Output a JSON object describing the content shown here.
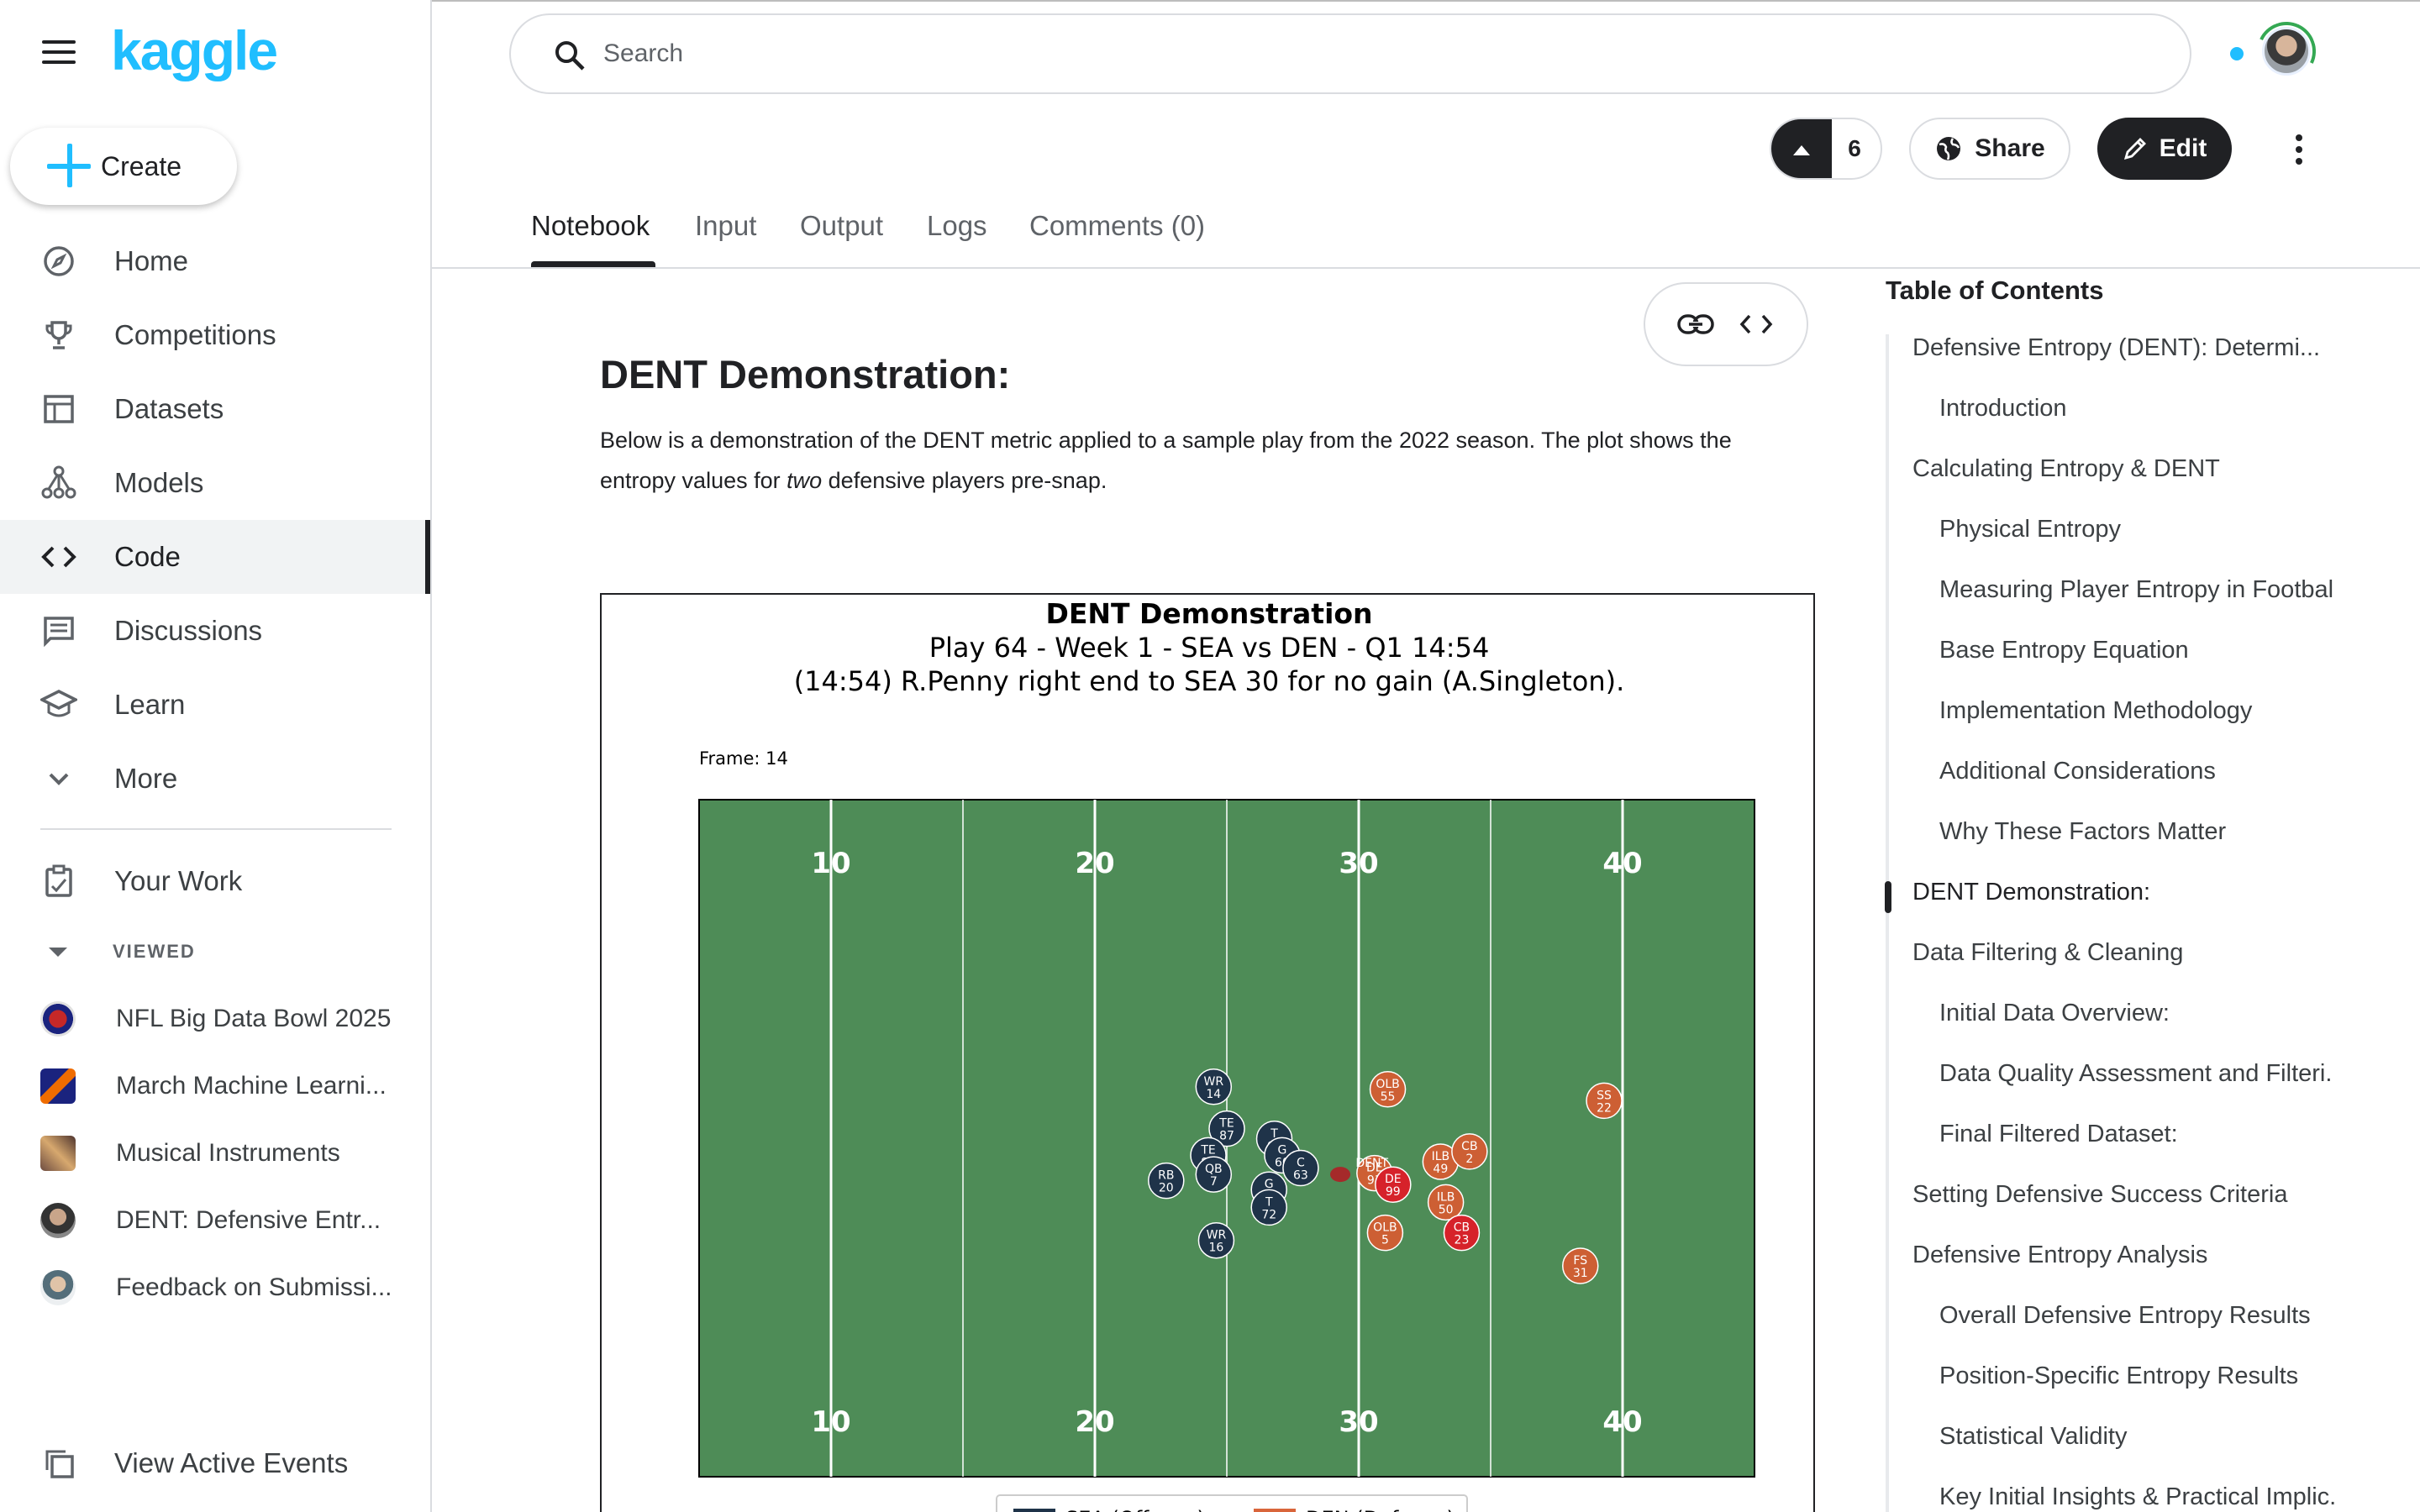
{
  "sidebar": {
    "logo": "kaggle",
    "create_label": "Create",
    "nav": [
      {
        "label": "Home",
        "icon": "compass-icon"
      },
      {
        "label": "Competitions",
        "icon": "trophy-icon"
      },
      {
        "label": "Datasets",
        "icon": "table-icon"
      },
      {
        "label": "Models",
        "icon": "models-icon"
      },
      {
        "label": "Code",
        "icon": "code-icon",
        "active": true
      },
      {
        "label": "Discussions",
        "icon": "discussions-icon"
      },
      {
        "label": "Learn",
        "icon": "learn-icon"
      },
      {
        "label": "More",
        "icon": "chevron-down-icon"
      }
    ],
    "your_work": "Your Work",
    "viewed_label": "VIEWED",
    "recent": [
      {
        "label": "NFL Big Data Bowl 2025"
      },
      {
        "label": "March Machine Learni..."
      },
      {
        "label": "Musical Instruments"
      },
      {
        "label": "DENT: Defensive Entr..."
      },
      {
        "label": "Feedback on Submissi..."
      }
    ],
    "view_active_events": "View Active Events"
  },
  "header": {
    "search_placeholder": "Search",
    "upvotes": "6",
    "share_label": "Share",
    "edit_label": "Edit"
  },
  "tabs": [
    {
      "label": "Notebook",
      "active": true
    },
    {
      "label": "Input"
    },
    {
      "label": "Output"
    },
    {
      "label": "Logs"
    },
    {
      "label": "Comments (0)"
    }
  ],
  "notebook": {
    "heading": "DENT Demonstration:",
    "para_pre": "Below is a demonstration of the DENT metric applied to a sample play from the 2022 season. The plot shows the entropy values for ",
    "para_em": "two",
    "para_post": " defensive players pre-snap."
  },
  "chart_data": {
    "type": "scatter",
    "title": "DENT Demonstration",
    "subtitle_1": "Play 64 - Week 1 - SEA vs DEN - Q1 14:54",
    "subtitle_2": "(14:54) R.Penny right end to SEA 30 for no gain (A.Singleton).",
    "frame_label": "Frame: 14",
    "field_color": "#4e8c57",
    "xlim": [
      5,
      45
    ],
    "ylim": [
      0,
      53.3
    ],
    "yard_numbers": [
      "10",
      "20",
      "30",
      "40"
    ],
    "legend": [
      {
        "label": "SEA (Offense)",
        "color": "#1f3349"
      },
      {
        "label": "DEN (Defense)",
        "color": "#d9653b"
      }
    ],
    "offense_color": "#1f3349",
    "defense_color": "#cd5f34",
    "dent_color": "#d6222a",
    "players": [
      {
        "team": "SEA",
        "pos": "WR",
        "num": "14",
        "x": 24.5,
        "y": 30.7
      },
      {
        "team": "SEA",
        "pos": "TE",
        "num": "87",
        "x": 25.0,
        "y": 27.4
      },
      {
        "team": "SEA",
        "pos": "TE",
        "num": "89",
        "x": 24.3,
        "y": 25.3
      },
      {
        "team": "SEA",
        "pos": "RB",
        "num": "20",
        "x": 22.7,
        "y": 23.3
      },
      {
        "team": "SEA",
        "pos": "QB",
        "num": "7",
        "x": 24.5,
        "y": 23.8
      },
      {
        "team": "SEA",
        "pos": "T",
        "num": "67",
        "x": 26.8,
        "y": 26.6
      },
      {
        "team": "SEA",
        "pos": "G",
        "num": "60",
        "x": 27.1,
        "y": 25.3
      },
      {
        "team": "SEA",
        "pos": "C",
        "num": "63",
        "x": 27.8,
        "y": 24.3
      },
      {
        "team": "SEA",
        "pos": "G",
        "num": "66",
        "x": 26.6,
        "y": 22.6
      },
      {
        "team": "SEA",
        "pos": "T",
        "num": "72",
        "x": 26.6,
        "y": 21.2
      },
      {
        "team": "SEA",
        "pos": "WR",
        "num": "16",
        "x": 24.6,
        "y": 18.6
      },
      {
        "team": "DEN",
        "pos": "OLB",
        "num": "55",
        "x": 31.1,
        "y": 30.5
      },
      {
        "team": "DEN",
        "pos": "DE",
        "num": "93",
        "x": 30.6,
        "y": 23.9
      },
      {
        "team": "DEN",
        "pos": "DE",
        "num": "99",
        "x": 31.3,
        "y": 23.0
      },
      {
        "team": "DEN",
        "pos": "ILB",
        "num": "49",
        "x": 33.1,
        "y": 24.8
      },
      {
        "team": "DEN",
        "pos": "CB",
        "num": "2",
        "x": 34.2,
        "y": 25.6
      },
      {
        "team": "DEN",
        "pos": "ILB",
        "num": "50",
        "x": 33.3,
        "y": 21.6
      },
      {
        "team": "DEN",
        "pos": "OLB",
        "num": "5",
        "x": 31.0,
        "y": 19.2
      },
      {
        "team": "DEN",
        "pos": "CB",
        "num": "23",
        "x": 33.9,
        "y": 19.2
      },
      {
        "team": "DEN",
        "pos": "SS",
        "num": "22",
        "x": 39.3,
        "y": 29.6
      },
      {
        "team": "DEN",
        "pos": "FS",
        "num": "31",
        "x": 38.4,
        "y": 16.6
      }
    ],
    "dent_marker": {
      "label": "DENT",
      "x": 30.5,
      "y": 24.8
    },
    "football": {
      "x": 29.3,
      "y": 23.8
    }
  },
  "toc": {
    "title": "Table of Contents",
    "items": [
      {
        "label": "Defensive Entropy (DENT): Determi...",
        "level": 1
      },
      {
        "label": "Introduction",
        "level": 2
      },
      {
        "label": "Calculating Entropy & DENT",
        "level": 1
      },
      {
        "label": "Physical Entropy",
        "level": 2
      },
      {
        "label": "Measuring Player Entropy in Footbal",
        "level": 2
      },
      {
        "label": "Base Entropy Equation",
        "level": 2
      },
      {
        "label": "Implementation Methodology",
        "level": 2
      },
      {
        "label": "Additional Considerations",
        "level": 2
      },
      {
        "label": "Why These Factors Matter",
        "level": 2
      },
      {
        "label": "DENT Demonstration:",
        "level": 1,
        "active": true
      },
      {
        "label": "Data Filtering & Cleaning",
        "level": 1
      },
      {
        "label": "Initial Data Overview:",
        "level": 2
      },
      {
        "label": "Data Quality Assessment and Filteri.",
        "level": 2
      },
      {
        "label": "Final Filtered Dataset:",
        "level": 2
      },
      {
        "label": "Setting Defensive Success Criteria",
        "level": 1
      },
      {
        "label": "Defensive Entropy Analysis",
        "level": 1
      },
      {
        "label": "Overall Defensive Entropy Results",
        "level": 2
      },
      {
        "label": "Position-Specific Entropy Results",
        "level": 2
      },
      {
        "label": "Statistical Validity",
        "level": 2
      },
      {
        "label": "Key Initial Insights & Practical Implic.",
        "level": 2
      }
    ]
  }
}
